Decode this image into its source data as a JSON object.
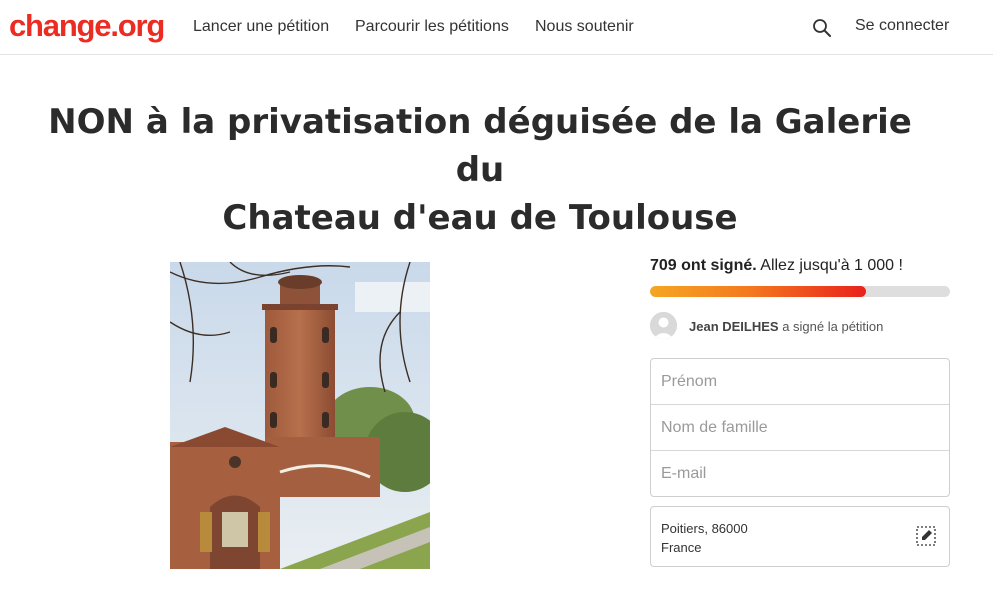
{
  "header": {
    "logo": "change.org",
    "nav": [
      "Lancer une pétition",
      "Parcourir les pétitions",
      "Nous soutenir"
    ],
    "login": "Se connecter"
  },
  "petition": {
    "title_line1": "NON à la privatisation déguisée de la Galerie du",
    "title_line2": "Chateau d'eau de Toulouse"
  },
  "signatures": {
    "count_text": "709 ont signé.",
    "goal_text": " Allez jusqu'à 1 000 !",
    "progress_fraction": 0.72
  },
  "recent_signer": {
    "name": "Jean DEILHES",
    "action": " a signé la pétition"
  },
  "form": {
    "first_name_placeholder": "Prénom",
    "last_name_placeholder": "Nom de famille",
    "email_placeholder": "E-mail"
  },
  "location": {
    "line1": "Poitiers, 86000",
    "line2": "France"
  },
  "colors": {
    "brand": "#ec2c22",
    "progress_start": "#f5a623",
    "progress_end": "#e8221c"
  }
}
